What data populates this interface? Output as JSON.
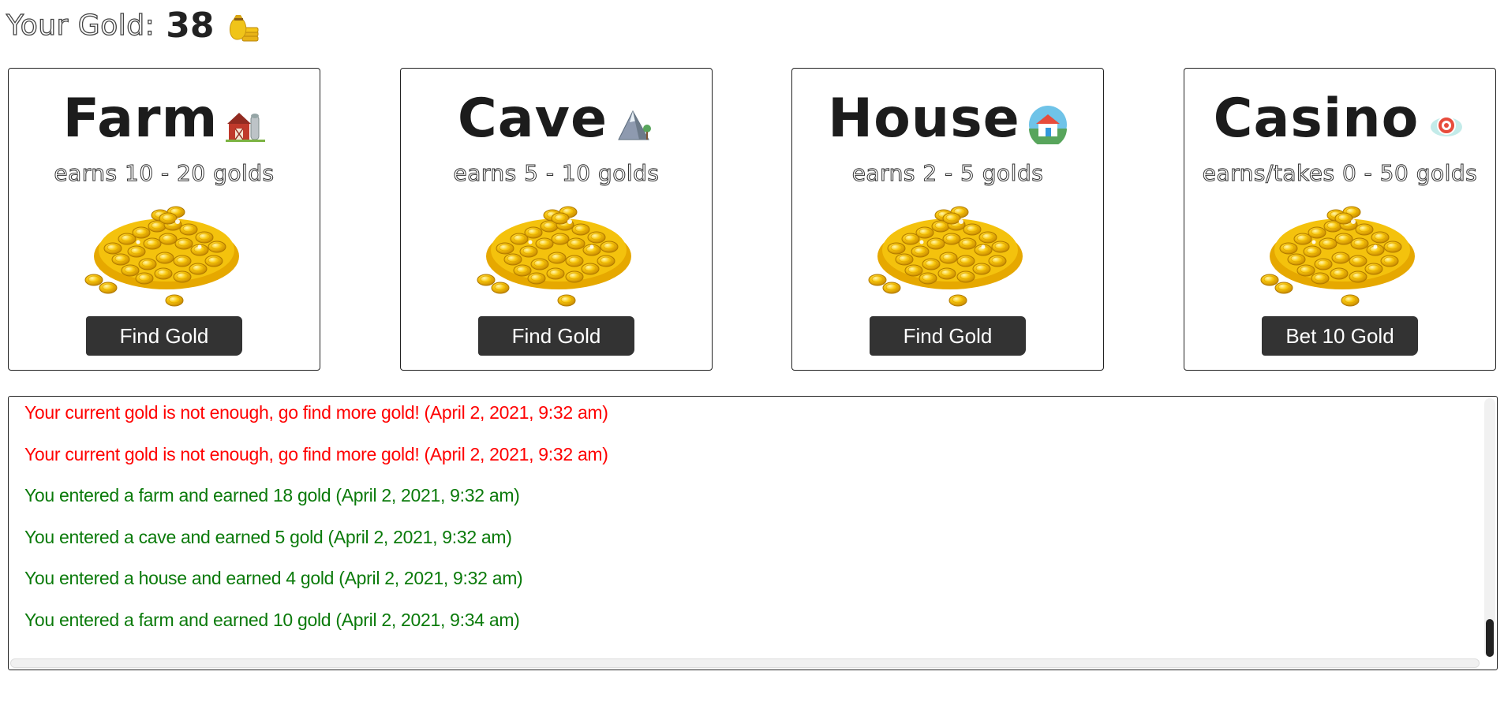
{
  "header": {
    "gold_label": "Your Gold:",
    "gold_amount": "38",
    "gold_icon": "moneybag-icon"
  },
  "cards": [
    {
      "title": "Farm",
      "icon": "barn-icon",
      "earns": "earns 10 - 20 golds",
      "image": "gold-coins-pile",
      "button_label": "Find Gold"
    },
    {
      "title": "Cave",
      "icon": "mountain-icon",
      "earns": "earns 5 - 10 golds",
      "image": "gold-coins-pile",
      "button_label": "Find Gold"
    },
    {
      "title": "House",
      "icon": "house-icon",
      "earns": "earns 2 - 5 golds",
      "image": "gold-coins-pile",
      "button_label": "Find Gold"
    },
    {
      "title": "Casino",
      "icon": "casino-chip-icon",
      "earns": "earns/takes 0 - 50 golds",
      "image": "gold-coins-pile",
      "button_label": "Bet 10 Gold"
    }
  ],
  "log": {
    "entries": [
      {
        "text": "Your current gold is not enough, go find more gold! (April 2, 2021, 9:32 am)",
        "type": "fail"
      },
      {
        "text": "Your current gold is not enough, go find more gold! (April 2, 2021, 9:32 am)",
        "type": "fail"
      },
      {
        "text": "You entered a farm and earned 18 gold (April 2, 2021, 9:32 am)",
        "type": "earn"
      },
      {
        "text": "You entered a cave and earned 5 gold (April 2, 2021, 9:32 am)",
        "type": "earn"
      },
      {
        "text": "You entered a house and earned 4 gold (April 2, 2021, 9:32 am)",
        "type": "earn"
      },
      {
        "text": "You entered a farm and earned 10 gold (April 2, 2021, 9:34 am)",
        "type": "earn"
      }
    ]
  },
  "colors": {
    "fail": "#ff0000",
    "earn": "#0a7a0a",
    "button_bg": "#333333",
    "gold": "#f2b705"
  }
}
